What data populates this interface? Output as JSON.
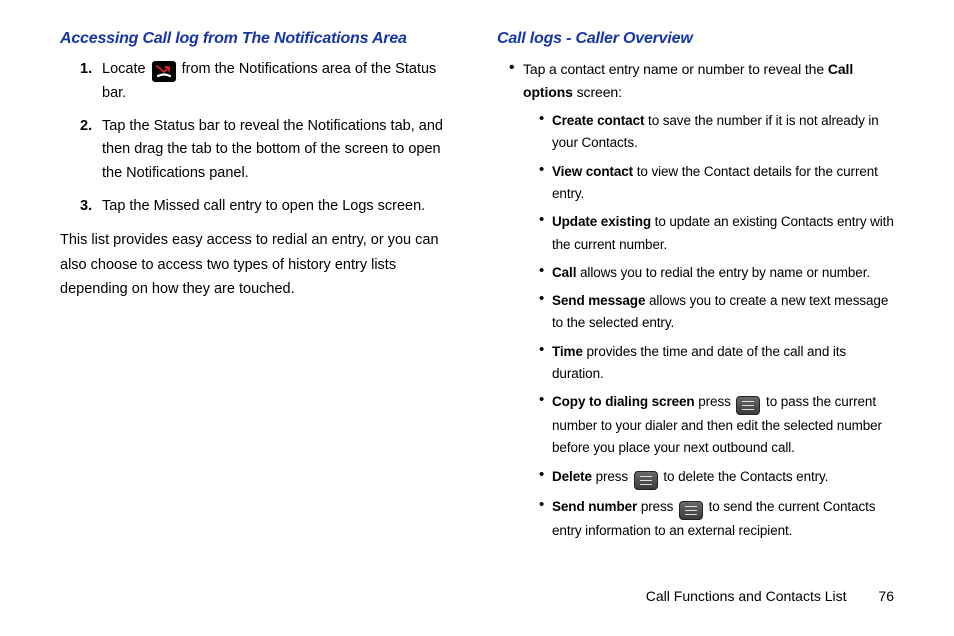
{
  "left": {
    "heading": "Accessing Call log from The Notifications Area",
    "steps": [
      {
        "num": "1.",
        "pre": "Locate ",
        "post": " from the Notifications area of the Status bar."
      },
      {
        "num": "2.",
        "text": "Tap the Status bar to reveal the Notifications tab, and then drag the tab to the bottom of the screen to open the Notifications panel."
      },
      {
        "num": "3.",
        "text": "Tap the Missed call entry to open the Logs screen."
      }
    ],
    "para": "This list provides easy access to redial an entry, or you can also choose to access two types of history entry lists depending on how they are touched."
  },
  "right": {
    "heading": "Call logs - Caller Overview",
    "l1_pre": "Tap a contact entry name or number to reveal the ",
    "l1_bold": "Call options",
    "l1_post": " screen:",
    "items": [
      {
        "bold": "Create contact",
        "rest": " to save the number if it is not already in your Contacts."
      },
      {
        "bold": "View contact",
        "rest": " to view the Contact details for the current entry."
      },
      {
        "bold": "Update existing",
        "rest": " to update an existing Contacts entry with the current number."
      },
      {
        "bold": "Call",
        "rest": " allows you to redial the entry by name or number."
      },
      {
        "bold": "Send message",
        "rest": " allows you to create a new text message to the selected entry."
      },
      {
        "bold": "Time",
        "rest": " provides the time and date of the call and its duration."
      },
      {
        "bold": "Copy to dialing screen",
        "rest_pre": " press ",
        "rest_post": " to pass the current number to your dialer and then edit the selected number before you place your next outbound call.",
        "icon": true
      },
      {
        "bold": "Delete",
        "rest_pre": " press ",
        "rest_post": " to delete the Contacts entry.",
        "icon": true
      },
      {
        "bold": "Send number",
        "rest_pre": " press ",
        "rest_post": " to send the current Contacts entry information to an external recipient.",
        "icon": true
      }
    ]
  },
  "footer": {
    "label": "Call Functions and Contacts List",
    "page": "76"
  }
}
